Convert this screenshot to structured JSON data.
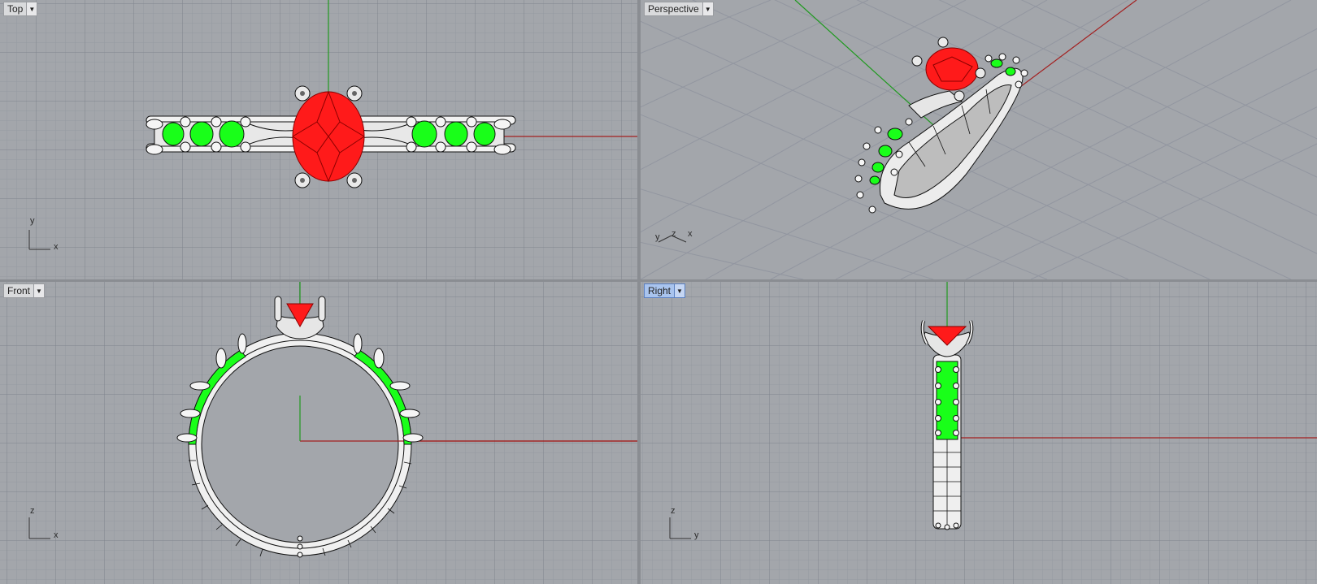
{
  "viewports": {
    "top": {
      "title": "Top",
      "axis_h": "x",
      "axis_v": "y"
    },
    "perspective": {
      "title": "Perspective",
      "axis_x": "x",
      "axis_y": "y",
      "axis_z": "z"
    },
    "front": {
      "title": "Front",
      "axis_h": "x",
      "axis_v": "z"
    },
    "right": {
      "title": "Right",
      "axis_h": "y",
      "axis_v": "z",
      "active": true
    }
  },
  "icons": {
    "dropdown": "chevron-down-icon"
  },
  "colors": {
    "background": "#a3a6ab",
    "grid_minor": "#9398a0",
    "grid_major": "#7e838b",
    "x_axis": "#a32020",
    "y_axis": "#1f9a1f",
    "gem_center": "#ff1a1a",
    "gem_side": "#19ff19",
    "metal": "#f2f2f2",
    "active_tab": "#a9c4ee"
  }
}
